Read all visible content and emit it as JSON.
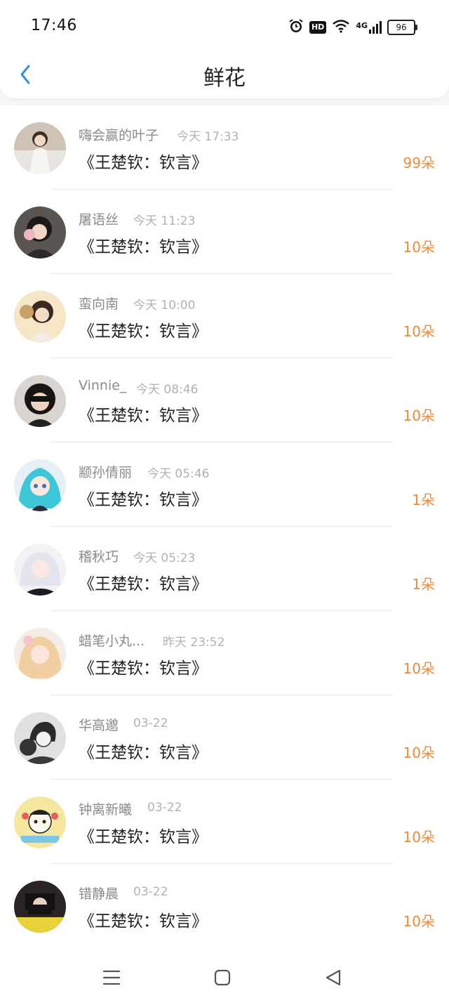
{
  "status_bar": {
    "time": "17:46",
    "icons": [
      "alarm-icon",
      "hd-icon",
      "wifi-icon",
      "4g-signal-icon",
      "battery-icon"
    ],
    "hd_label": "HD",
    "network_label": "4G",
    "battery": "96"
  },
  "header": {
    "title": "鲜花",
    "back_icon": "chevron-left-icon",
    "accent_color": "#2f8fe0"
  },
  "colors": {
    "count": "#ef8a3c",
    "name": "#8a8a8a",
    "time": "#b2b2b2"
  },
  "rows": [
    {
      "name": "嗨会赢的叶子",
      "time": "今天 17:33",
      "book": "《王楚钦：钦言》",
      "count": "99朵"
    },
    {
      "name": "屠语丝",
      "time": "今天 11:23",
      "book": "《王楚钦：钦言》",
      "count": "10朵"
    },
    {
      "name": "蛮向南",
      "time": "今天 10:00",
      "book": "《王楚钦：钦言》",
      "count": "10朵"
    },
    {
      "name": "Vinnie_",
      "time": "今天 08:46",
      "book": "《王楚钦：钦言》",
      "count": "10朵"
    },
    {
      "name": "颛孙倩丽",
      "time": "今天 05:46",
      "book": "《王楚钦：钦言》",
      "count": "1朵"
    },
    {
      "name": "稽秋巧",
      "time": "今天 05:23",
      "book": "《王楚钦：钦言》",
      "count": "1朵"
    },
    {
      "name": "蜡笔小丸...",
      "time": "昨天 23:52",
      "book": "《王楚钦：钦言》",
      "count": "10朵"
    },
    {
      "name": "华高邈",
      "time": "03-22",
      "book": "《王楚钦：钦言》",
      "count": "10朵"
    },
    {
      "name": "钟离新曦",
      "time": "03-22",
      "book": "《王楚钦：钦言》",
      "count": "10朵"
    },
    {
      "name": "错静晨",
      "time": "03-22",
      "book": "《王楚钦：钦言》",
      "count": "10朵"
    }
  ],
  "bottom_nav": [
    "menu-icon",
    "home-square-icon",
    "back-triangle-icon"
  ]
}
